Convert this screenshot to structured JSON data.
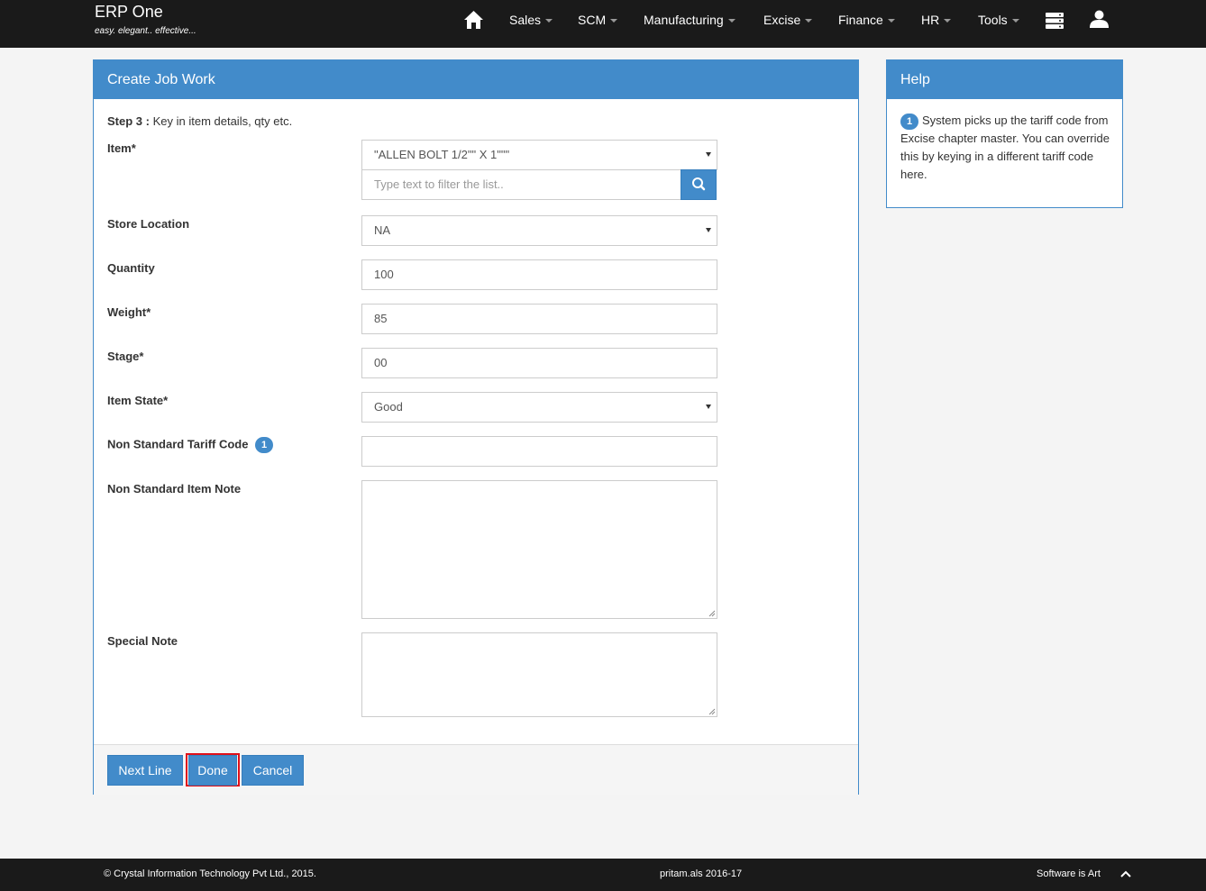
{
  "brand": {
    "title": "ERP One",
    "tagline": "easy. elegant.. effective..."
  },
  "nav": {
    "home_icon": "home-icon",
    "items": [
      {
        "label": "Sales"
      },
      {
        "label": "SCM"
      },
      {
        "label": "Manufacturing"
      },
      {
        "label": "Excise"
      },
      {
        "label": "Finance"
      },
      {
        "label": "HR"
      },
      {
        "label": "Tools"
      }
    ],
    "menu_icon": "stack-icon",
    "user_icon": "user-icon"
  },
  "form": {
    "title": "Create Job Work",
    "step_label": "Step 3 :",
    "step_text": "Key in item details, qty etc.",
    "item": {
      "label": "Item*",
      "value": "\"ALLEN BOLT 1/2\"\" X 1\"\"\"",
      "filter_placeholder": "Type text to filter the list.."
    },
    "store_location": {
      "label": "Store Location",
      "value": "NA"
    },
    "quantity": {
      "label": "Quantity",
      "value": "100"
    },
    "weight": {
      "label": "Weight*",
      "value": "85"
    },
    "stage": {
      "label": "Stage*",
      "value": "00"
    },
    "item_state": {
      "label": "Item State*",
      "value": "Good"
    },
    "tariff_code": {
      "label": "Non Standard Tariff Code",
      "badge": "1",
      "value": ""
    },
    "item_note": {
      "label": "Non Standard Item Note",
      "value": ""
    },
    "special_note": {
      "label": "Special Note",
      "value": ""
    },
    "buttons": {
      "next_line": "Next Line",
      "done": "Done",
      "cancel": "Cancel"
    }
  },
  "help": {
    "title": "Help",
    "badge": "1",
    "text": "System picks up the tariff code from Excise chapter master. You can override this by keying in a different tariff code here."
  },
  "footer": {
    "copyright": "© Crystal Information Technology Pvt Ltd., 2015.",
    "session": "pritam.als 2016-17",
    "slogan": "Software is Art"
  },
  "colors": {
    "primary": "#428bca",
    "navbar": "#1a1a1a",
    "highlight": "#e0101a"
  }
}
